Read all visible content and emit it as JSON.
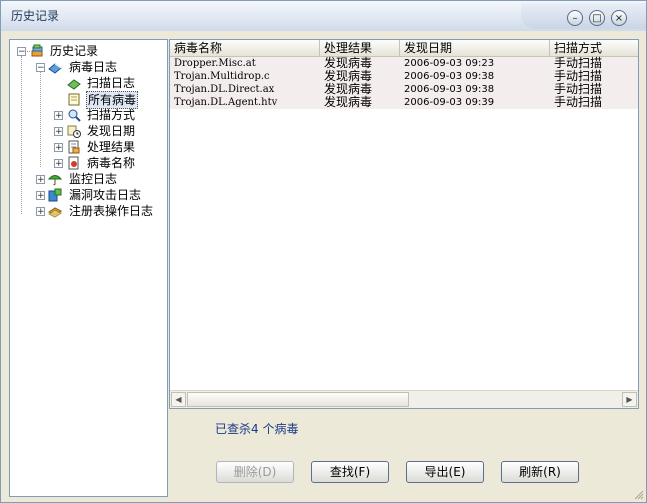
{
  "window": {
    "title": "历史记录"
  },
  "title_buttons": [
    {
      "name": "minimize-button",
      "glyph": "–"
    },
    {
      "name": "maximize-button",
      "glyph": "□"
    },
    {
      "name": "close-button",
      "glyph": "×"
    }
  ],
  "tree": [
    {
      "label": "历史记录",
      "icon": "history-books-icon",
      "expander": "−",
      "level": 0
    },
    {
      "label": "病毒日志",
      "icon": "virus-log-book-icon",
      "expander": "−",
      "level": 1
    },
    {
      "label": "扫描日志",
      "icon": "scan-log-book-icon",
      "expander": "",
      "level": 2
    },
    {
      "label": "所有病毒",
      "icon": "all-viruses-doc-icon",
      "expander": "",
      "level": 2,
      "selected": true
    },
    {
      "label": "扫描方式",
      "icon": "scan-mode-icon",
      "expander": "+",
      "level": 2
    },
    {
      "label": "发现日期",
      "icon": "found-date-clock-icon",
      "expander": "+",
      "level": 2
    },
    {
      "label": "处理结果",
      "icon": "process-result-icon",
      "expander": "+",
      "level": 2
    },
    {
      "label": "病毒名称",
      "icon": "virus-name-icon",
      "expander": "+",
      "level": 2
    },
    {
      "label": "监控日志",
      "icon": "monitor-umbrella-icon",
      "expander": "+",
      "level": 1
    },
    {
      "label": "漏洞攻击日志",
      "icon": "vulnerability-attack-icon",
      "expander": "+",
      "level": 1
    },
    {
      "label": "注册表操作日志",
      "icon": "registry-operation-icon",
      "expander": "+",
      "level": 1
    }
  ],
  "table": {
    "columns": [
      "病毒名称",
      "处理结果",
      "发现日期",
      "扫描方式"
    ],
    "rows": [
      [
        "Dropper.Misc.at",
        "发现病毒",
        "2006-09-03 09:23",
        "手动扫描"
      ],
      [
        "Trojan.Multidrop.c",
        "发现病毒",
        "2006-09-03 09:38",
        "手动扫描"
      ],
      [
        "Trojan.DL.Direct.ax",
        "发现病毒",
        "2006-09-03 09:38",
        "手动扫描"
      ],
      [
        "Trojan.DL.Agent.htv",
        "发现病毒",
        "2006-09-03 09:39",
        "手动扫描"
      ]
    ]
  },
  "status": {
    "text": "已查杀4 个病毒"
  },
  "buttons": {
    "delete": "删除(D)",
    "find": "查找(F)",
    "export": "导出(E)",
    "refresh": "刷新(R)"
  },
  "colors": {
    "selected_row_bg": "#f4eded",
    "status_text": "#1a3a8a"
  }
}
